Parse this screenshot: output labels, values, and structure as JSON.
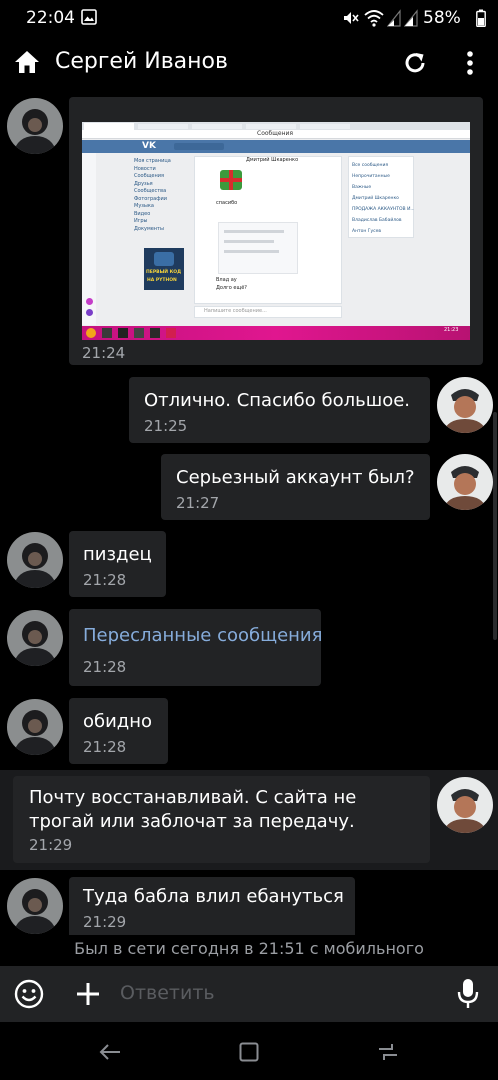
{
  "status_bar": {
    "time": "22:04",
    "battery": "58%",
    "icons": [
      "image-icon",
      "mute-icon",
      "wifi-icon",
      "signal-icon",
      "signal-icon",
      "battery-icon"
    ]
  },
  "header": {
    "title": "Сергей Иванов",
    "home_icon": "home-icon",
    "refresh_icon": "refresh-icon",
    "menu_icon": "more-vertical-icon"
  },
  "messages": [
    {
      "id": "screenshot",
      "time": "21:24",
      "outgoing": false
    },
    {
      "id": "m1",
      "text": "Отлично.  Спасибо большое.",
      "time": "21:25",
      "outgoing": true
    },
    {
      "id": "m2",
      "text": "Серьезный аккаунт был?",
      "time": "21:27",
      "outgoing": true
    },
    {
      "id": "m3",
      "text": "пиздец",
      "time": "21:28",
      "outgoing": false
    },
    {
      "id": "m4",
      "text": "Пересланные сообщения",
      "time": "21:28",
      "outgoing": false
    },
    {
      "id": "m5",
      "text": "обидно",
      "time": "21:28",
      "outgoing": false
    },
    {
      "id": "m6",
      "line1": "Почту восстанавливай. С сайта не",
      "line2": "трогай или заблочат за передачу.",
      "time": "21:29",
      "outgoing": true
    },
    {
      "id": "m7",
      "text": "Туда бабла влил ебануться",
      "time": "21:29",
      "outgoing": false
    }
  ],
  "presence": "Был в сети сегодня в 21:51 с мобильного",
  "composer": {
    "placeholder": "Ответить",
    "emoji_icon": "emoji-icon",
    "attach_icon": "plus-icon",
    "mic_icon": "microphone-icon"
  },
  "navigation": {
    "back_icon": "back-icon",
    "home_icon": "home-square-icon",
    "recents_icon": "recents-icon"
  },
  "embedded_screenshot": {
    "title_bar": "Сообщения",
    "chat_partner": "Дмитрий Шкаренко",
    "menu": [
      "Моя страница",
      "Новости",
      "Сообщения",
      "Друзья",
      "Сообщества",
      "Фотографии",
      "Музыка",
      "Видео",
      "Игры",
      "Документы"
    ],
    "right_list": [
      "Все сообщения",
      "Непрочитанные",
      "Важные",
      "Дмитрий Шкаренко",
      "ПРОДАЖА АККАУНТОВ И...",
      "Владислав Бабайлов",
      "Антон Гусев"
    ],
    "ad_line1": "ПЕРВЫЙ КОД",
    "ad_line2": "НА PYTHON",
    "msg_a": "спасибо",
    "msg_b": "Влад ау",
    "msg_c": "Долго ещё?",
    "input_hint": "Напишите сообщение...",
    "taskbar_time": "21:23"
  }
}
